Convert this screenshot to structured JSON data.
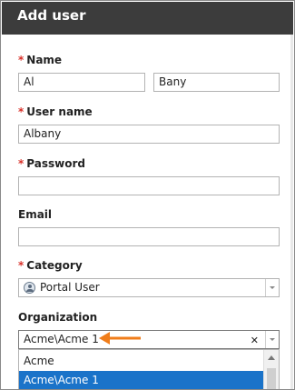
{
  "dialog": {
    "title": "Add user"
  },
  "form": {
    "name": {
      "label": "Name",
      "required": "*",
      "first": "Al",
      "last": "Bany"
    },
    "username": {
      "label": "User name",
      "required": "*",
      "value": "Albany"
    },
    "password": {
      "label": "Password",
      "required": "*",
      "value": ""
    },
    "email": {
      "label": "Email",
      "value": ""
    },
    "category": {
      "label": "Category",
      "required": "*",
      "value": "Portal User",
      "icon": "person-icon"
    },
    "organization": {
      "label": "Organization",
      "value": "Acme\\Acme 1",
      "clear": "✕"
    }
  },
  "dropdown": {
    "options": [
      {
        "label": "Acme",
        "selected": false
      },
      {
        "label": "Acme\\Acme 1",
        "selected": true
      }
    ]
  },
  "colors": {
    "header": "#3c3c3c",
    "required": "#d9312a",
    "selection": "#1a73c9",
    "pointer_arrow": "#f07d1a"
  }
}
